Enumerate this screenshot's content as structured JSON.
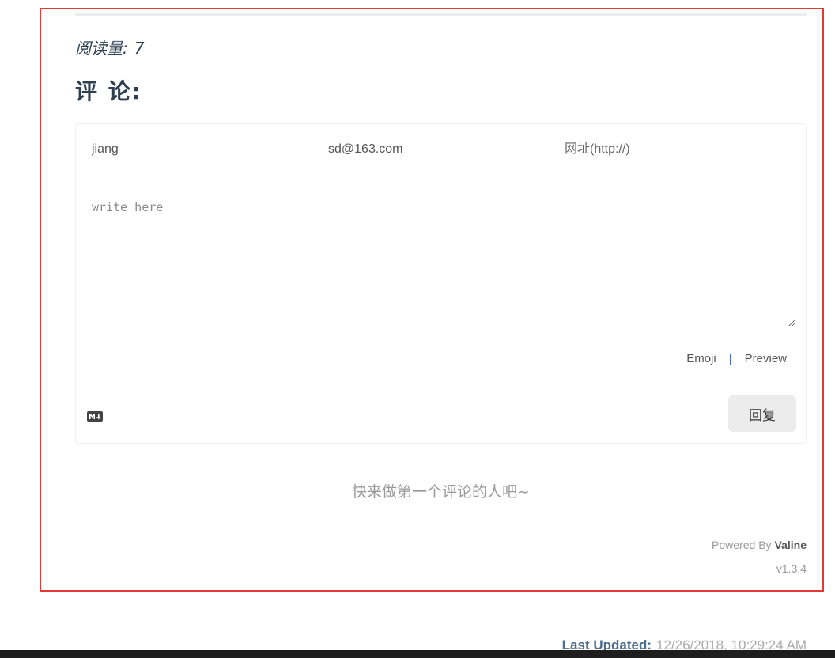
{
  "read_count": {
    "label": "阅读量:",
    "value": "7"
  },
  "comments_heading": "评 论:",
  "comment_form": {
    "nick_value": "jiang",
    "mail_value": "sd@163.com",
    "link_placeholder": "网址(http://)",
    "content_placeholder": "write here",
    "emoji_label": "Emoji",
    "separator": "|",
    "preview_label": "Preview",
    "markdown_icon": "markdown-icon",
    "submit_label": "回复"
  },
  "empty_message": "快来做第一个评论的人吧~",
  "footer": {
    "powered_by_prefix": "Powered By",
    "powered_by_brand": "Valine",
    "version": "v1.3.4"
  },
  "last_updated": {
    "label": "Last Updated:",
    "value": "12/26/2018, 10:29:24 AM"
  },
  "colors": {
    "highlight_frame": "#e53935",
    "heading_text": "#2c3e50",
    "muted_text": "#999999",
    "button_bg": "#ececec",
    "separator_accent": "#3b5bdb"
  }
}
